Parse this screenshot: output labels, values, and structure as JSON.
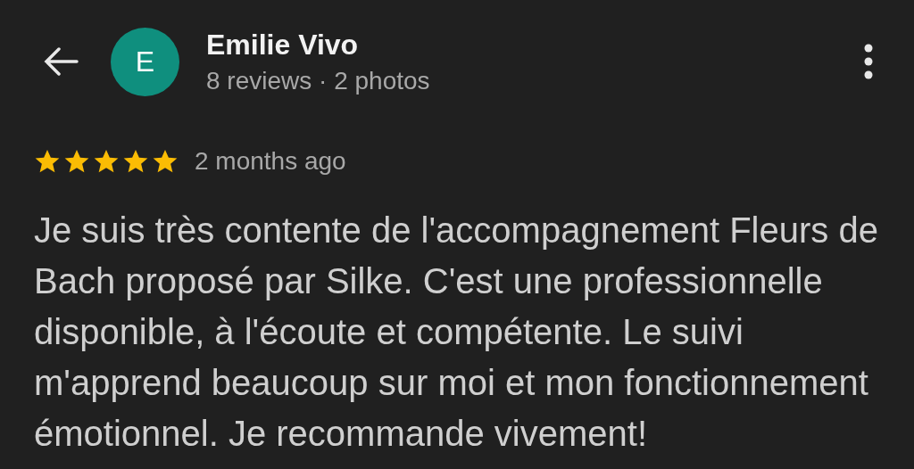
{
  "header": {
    "avatar_letter": "E",
    "name": "Emilie Vivo",
    "stats": "8 reviews · 2 photos"
  },
  "review": {
    "stars": 5,
    "time": "2 months ago",
    "text": "Je suis très contente de l'accompagnement Fleurs de Bach proposé par Silke. C'est une professionnelle disponible, à l'écoute et compétente. Le suivi m'apprend beaucoup sur moi et mon fonctionnement émotionnel. Je recommande vivement!"
  }
}
